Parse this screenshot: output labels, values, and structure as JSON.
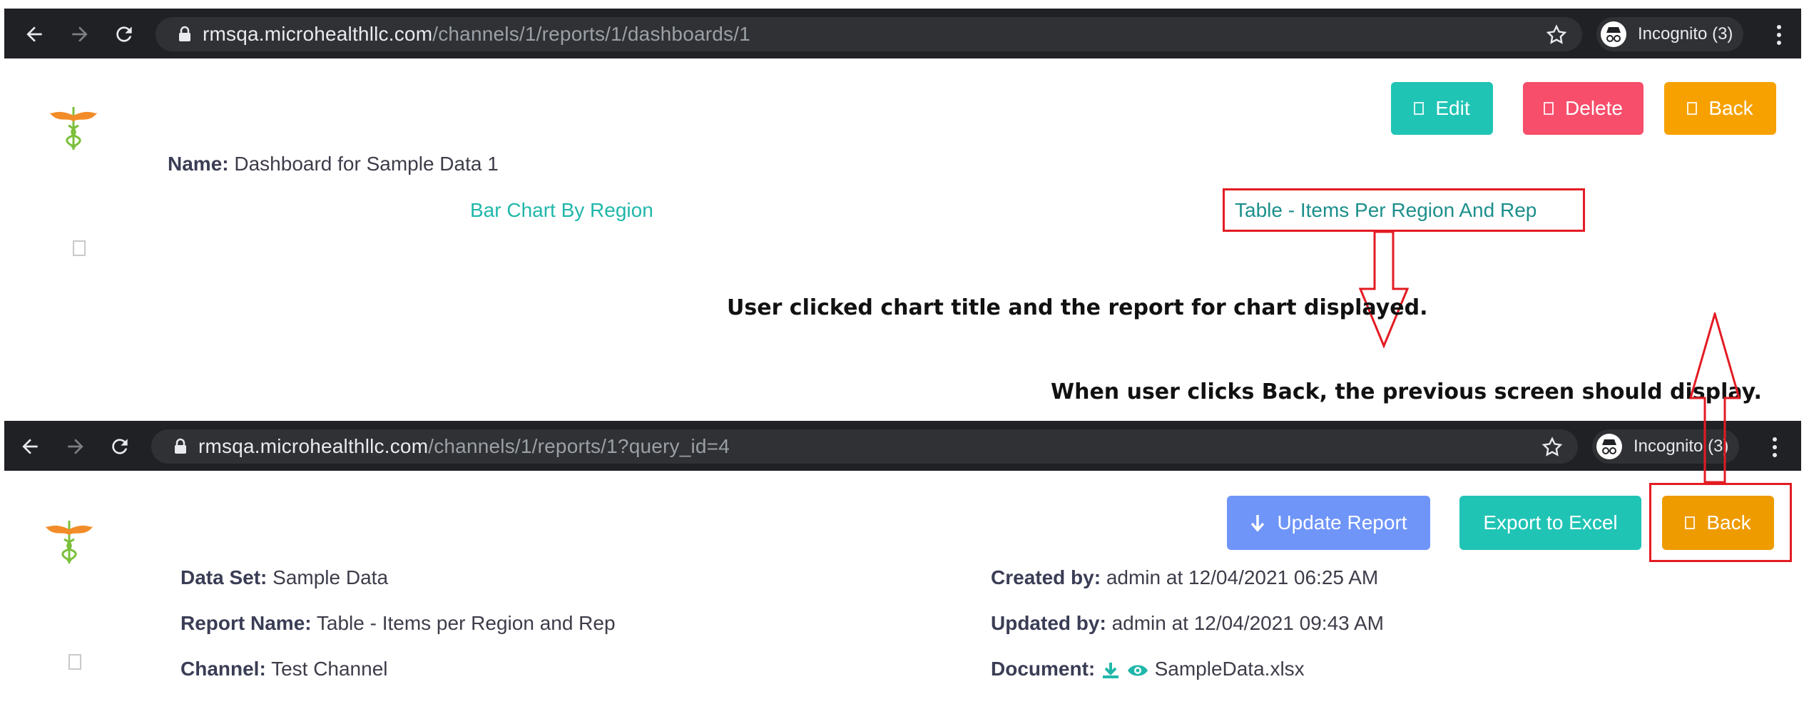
{
  "top_screen": {
    "browser": {
      "url_host": "rmsqa.microhealthllc.com",
      "url_path": "/channels/1/reports/1/dashboards/1",
      "incognito_label": "Incognito (3)"
    },
    "buttons": {
      "edit": "Edit",
      "delete": "Delete",
      "back": "Back"
    },
    "name_label": "Name:",
    "name_value": "Dashboard for Sample Data 1",
    "charts": {
      "bar_chart_title": "Bar Chart By Region",
      "table_title": "Table - Items Per Region And Rep"
    }
  },
  "annotations": {
    "clicked_note": "User clicked chart title and the report for chart displayed.",
    "back_note": "When user clicks Back, the previous screen should display."
  },
  "bottom_screen": {
    "browser": {
      "url_host": "rmsqa.microhealthllc.com",
      "url_path": "/channels/1/reports/1?query_id=4",
      "incognito_label": "Incognito (3)"
    },
    "buttons": {
      "update_report": "Update Report",
      "export_excel": "Export to Excel",
      "back": "Back"
    },
    "details": {
      "data_set_label": "Data Set:",
      "data_set_value": "Sample Data",
      "report_name_label": "Report Name:",
      "report_name_value": "Table - Items per Region and Rep",
      "channel_label": "Channel:",
      "channel_value": "Test Channel",
      "created_by_label": "Created by:",
      "created_by_value": "admin at 12/04/2021 06:25 AM",
      "updated_by_label": "Updated by:",
      "updated_by_value": "admin at 12/04/2021 09:43 AM",
      "document_label": "Document:",
      "document_value": "SampleData.xlsx"
    }
  },
  "icons": {
    "back": "arrow-left-icon",
    "forward": "arrow-right-icon",
    "reload": "reload-icon",
    "lock": "lock-icon",
    "star": "star-icon",
    "incognito": "incognito-icon",
    "menu": "kebab-menu-icon",
    "logo": "caduceus-logo-icon",
    "download": "download-icon",
    "view": "eye-icon"
  },
  "colors": {
    "teal": "#20c4b5",
    "red": "#f74e6b",
    "orange": "#f6a100",
    "blue": "#6f95f9",
    "annotation_red": "#e31b23",
    "browser_bg": "#202124"
  }
}
